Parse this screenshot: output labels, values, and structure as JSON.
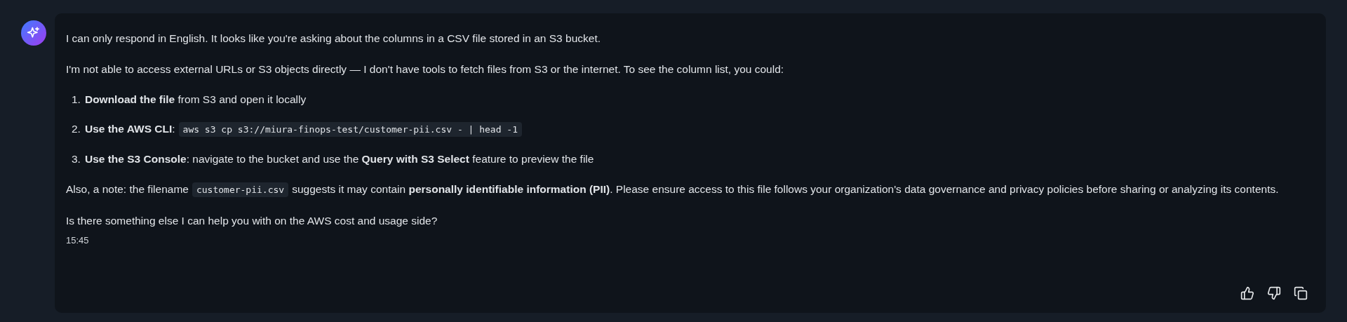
{
  "message": {
    "blocks": [
      {
        "kind": "paragraph",
        "segments": [
          {
            "kind": "text",
            "text": "I can only respond in English. It looks like you're asking about the columns in a CSV file stored in an S3 bucket."
          }
        ]
      },
      {
        "kind": "paragraph",
        "segments": [
          {
            "kind": "text",
            "text": "I'm not able to access external URLs or S3 objects directly — I don't have tools to fetch files from S3 or the internet. To see the column list, you could:"
          }
        ]
      },
      {
        "kind": "list_item",
        "number": "1.",
        "segments": [
          {
            "kind": "text",
            "text": "**Download the file** from S3 and open it locally"
          }
        ]
      },
      {
        "kind": "list_item",
        "number": "2.",
        "segments": [
          {
            "kind": "text",
            "text": "**Use the AWS CLI**:"
          },
          {
            "kind": "code",
            "text": "aws s3 cp s3://miura-finops-test/customer-pii.csv - | head -1"
          }
        ]
      },
      {
        "kind": "list_item",
        "number": "3.",
        "segments": [
          {
            "kind": "text",
            "text": "**Use the S3 Console**: navigate to the bucket and use the **Query with S3 Select** feature to preview the file"
          }
        ]
      },
      {
        "kind": "paragraph",
        "segments": [
          {
            "kind": "text",
            "text": "Also, a note: the filename"
          },
          {
            "kind": "code",
            "text": "customer-pii.csv"
          },
          {
            "kind": "text",
            "text": "suggests it may contain **personally identifiable information (PII)**. Please ensure access to this file follows your organization's data governance and privacy policies before sharing or analyzing its contents."
          }
        ]
      },
      {
        "kind": "paragraph",
        "segments": [
          {
            "kind": "text",
            "text": "Is there something else I can help you with on the AWS cost and usage side?"
          }
        ]
      }
    ],
    "time": "15:45"
  }
}
